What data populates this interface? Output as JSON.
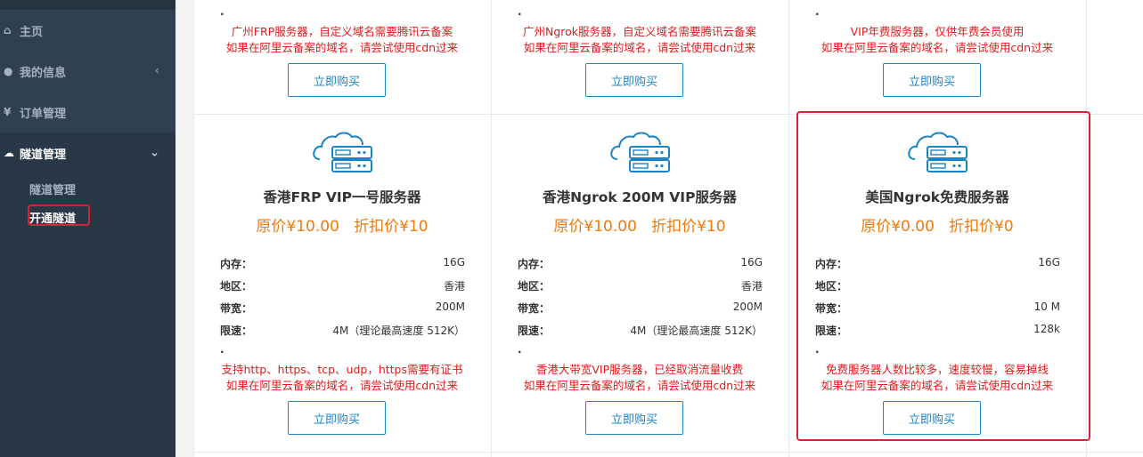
{
  "sidebar": {
    "items": [
      {
        "label": "主页",
        "icon": "home-icon",
        "glyph": "⌂"
      },
      {
        "label": "我的信息",
        "icon": "user-icon",
        "glyph": "●",
        "chevron": "‹"
      },
      {
        "label": "订单管理",
        "icon": "yen-icon",
        "glyph": "¥"
      },
      {
        "label": "隧道管理",
        "icon": "cloud-icon",
        "glyph": "☁",
        "chevron": "⌄",
        "active": true
      }
    ],
    "sub_items": [
      {
        "label": "隧道管理"
      },
      {
        "label": "开通隧道",
        "current": true
      }
    ]
  },
  "top_row": [
    {
      "dot": ".",
      "notes": [
        "广州FRP服务器，自定义域名需要腾讯云备案",
        "如果在阿里云备案的域名，请尝试使用cdn过来"
      ],
      "button": "立即购买"
    },
    {
      "dot": ".",
      "notes": [
        "广州Ngrok服务器，自定义域名需要腾讯云备案",
        "如果在阿里云备案的域名，请尝试使用cdn过来"
      ],
      "button": "立即购买"
    },
    {
      "dot": ".",
      "notes": [
        "VIP年费服务器，仅供年费会员使用",
        "如果在阿里云备案的域名，请尝试使用cdn过来"
      ],
      "button": "立即购买"
    }
  ],
  "cards": [
    {
      "title": "香港FRP VIP一号服务器",
      "price": "原价¥10.00   折扣价¥10",
      "specs": [
        {
          "key": "内存：",
          "value": "16G"
        },
        {
          "key": "地区：",
          "value": "香港"
        },
        {
          "key": "带宽：",
          "value": "200M"
        },
        {
          "key": "限速：",
          "value": "4M（理论最高速度 512K）"
        }
      ],
      "dot": ".",
      "notes": [
        "支持http、https、tcp、udp，https需要有证书",
        "如果在阿里云备案的域名，请尝试使用cdn过来"
      ],
      "button": "立即购买"
    },
    {
      "title": "香港Ngrok 200M VIP服务器",
      "price": "原价¥10.00   折扣价¥10",
      "specs": [
        {
          "key": "内存：",
          "value": "16G"
        },
        {
          "key": "地区：",
          "value": "香港"
        },
        {
          "key": "带宽：",
          "value": "200M"
        },
        {
          "key": "限速：",
          "value": "4M（理论最高速度 512K）"
        }
      ],
      "dot": ".",
      "notes": [
        "香港大带宽VIP服务器，已经取消流量收费",
        "如果在阿里云备案的域名，请尝试使用cdn过来"
      ],
      "button": "立即购买"
    },
    {
      "title": "美国Ngrok免费服务器",
      "price": "原价¥0.00   折扣价¥0",
      "specs": [
        {
          "key": "内存：",
          "value": "16G"
        },
        {
          "key": "地区：",
          "value": ""
        },
        {
          "key": "带宽：",
          "value": "10 M"
        },
        {
          "key": "限速：",
          "value": "128k"
        }
      ],
      "dot": ".",
      "notes": [
        "免费服务器人数比较多，速度较慢，容易掉线",
        "如果在阿里云备案的域名，请尝试使用cdn过来"
      ],
      "button": "立即购买"
    }
  ],
  "colors": {
    "sidebar_bg": "#2f4050",
    "accent": "#1c84c6",
    "price": "#f07a0a",
    "note_red": "#e01b1b",
    "highlight": "#d9213a"
  }
}
